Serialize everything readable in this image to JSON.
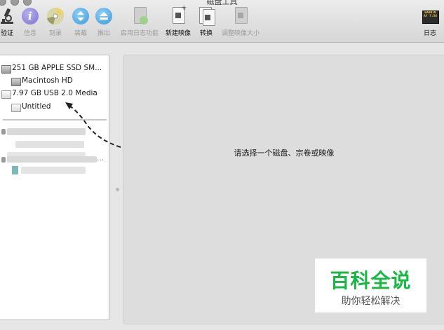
{
  "window": {
    "title": "磁盘工具"
  },
  "toolbar": {
    "verify": "验证",
    "info": "信息",
    "burn": "刻录",
    "mount": "装载",
    "eject": "推出",
    "enable_journaling": "启用日志功能",
    "new_image": "新建映像",
    "convert": "转换",
    "resize_image": "调整映像大小",
    "log": "日志",
    "log_icon_text": "WARNIN\nAY 7:36"
  },
  "sidebar": {
    "items": [
      {
        "label": "251 GB APPLE SSD SM..."
      },
      {
        "label": "Macintosh HD"
      },
      {
        "label": "7.97 GB USB 2.0 Media"
      },
      {
        "label": "Untitled"
      }
    ],
    "blurred_row_label": "..."
  },
  "main": {
    "message": "请选择一个磁盘、宗卷或映像"
  },
  "watermark": {
    "title": "百科全说",
    "subtitle": "助你轻松解决"
  },
  "colors": {
    "accent_green": "#19b845",
    "info_purple": "#8a80d6",
    "mount_blue": "#43a3e6"
  }
}
